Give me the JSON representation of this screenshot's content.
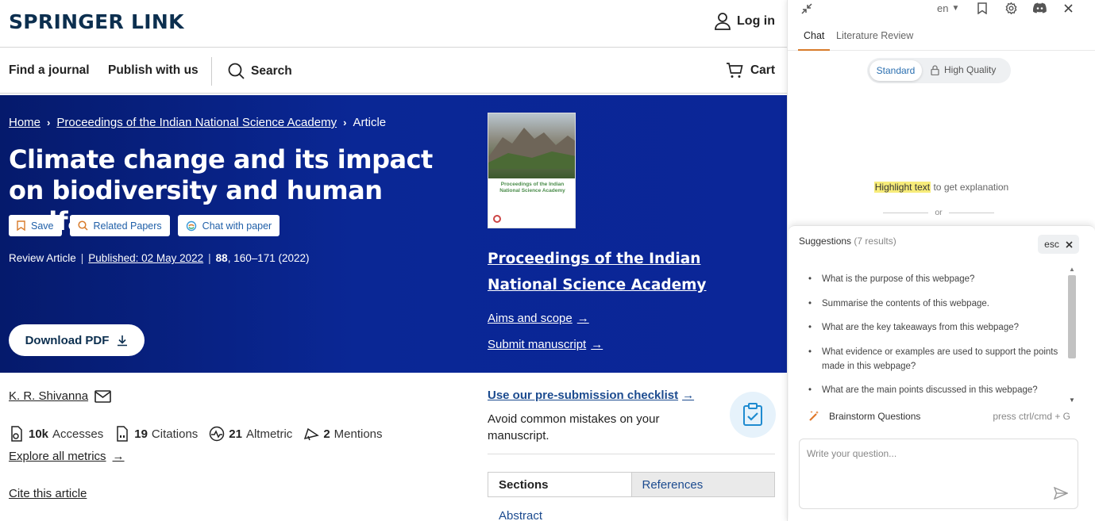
{
  "site": {
    "logo": "SPRINGER LINK",
    "login": "Log in",
    "nav": [
      "Find a journal",
      "Publish with us"
    ],
    "search": "Search",
    "cart": "Cart"
  },
  "breadcrumb": {
    "home": "Home",
    "journal": "Proceedings of the Indian National Science Academy",
    "current": "Article"
  },
  "article": {
    "title": "Climate change and its impact on biodiversity and human welfare",
    "actions": {
      "save": "Save",
      "related": "Related Papers",
      "chat": "Chat with paper"
    },
    "type": "Review Article",
    "published": "Published: 02 May 2022",
    "volume": "88",
    "pages": ", 160–171 (2022)",
    "download": "Download PDF",
    "author": "K. R. Shivanna",
    "metrics": {
      "accesses_value": "10k",
      "accesses_label": "Accesses",
      "citations_value": "19",
      "citations_label": "Citations",
      "altmetric_value": "21",
      "altmetric_label": "Altmetric",
      "mentions_value": "2",
      "mentions_label": "Mentions"
    },
    "explore": "Explore all metrics",
    "cite": "Cite this article"
  },
  "journal_box": {
    "cover_title": "Proceedings of the Indian National Science Academy",
    "name": "Proceedings of the Indian National Science Academy",
    "aims": "Aims and scope",
    "submit": "Submit manuscript",
    "checklist": "Use our pre-submission checklist",
    "avoid": "Avoid common mistakes on your manuscript.",
    "tabs": [
      "Sections",
      "References"
    ],
    "abstract": "Abstract"
  },
  "panel": {
    "lang": "en",
    "tabs": [
      "Chat",
      "Literature Review"
    ],
    "quality": [
      "Standard",
      "High Quality"
    ],
    "hint_highlight": "Highlight text",
    "hint_rest": " to get explanation",
    "or": "or",
    "suggestions_title": "Suggestions",
    "suggestions_count": "(7 results)",
    "esc": "esc",
    "suggestions": [
      "What is the purpose of this webpage?",
      "Summarise the contents of this webpage.",
      "What are the key takeaways from this webpage?",
      "What evidence or examples are used to support the points made in this webpage?",
      "What are the main points discussed in this webpage?"
    ],
    "brainstorm": "Brainstorm Questions",
    "brainstorm_shortcut": "press ctrl/cmd + G",
    "input_placeholder": "Write your question..."
  },
  "colors": {
    "hero_bg": "#0b2698",
    "logo": "#0c2f4f",
    "link_blue": "#1c4b8f",
    "accent_orange": "#d87b2a",
    "highlight": "#f7ec7a"
  }
}
